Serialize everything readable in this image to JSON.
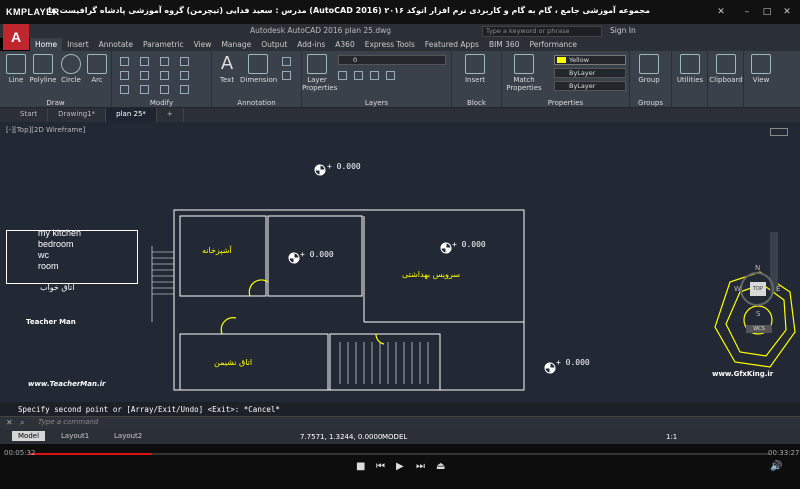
{
  "player": {
    "logo": "KMPLAYER",
    "title": "مجموعه آموزشی جامع ، گام به گام و کاربردی نرم افزار  اتوکد ۲۰۱۶ (AutoCAD 2016)  مدرس : سعید فدایی (تیچرمن) گروه آموزشی پادشاه گرافیست ها",
    "time_elapsed": "00:05:32",
    "time_total": "00:33:27",
    "progress": 0.1655
  },
  "acad": {
    "logo": "A",
    "doc_title": "Autodesk AutoCAD 2016  plan 25.dwg",
    "search_placeholder": "Type a keyword or phrase",
    "signin": "Sign In",
    "ribbon_tabs": [
      "Home",
      "Insert",
      "Annotate",
      "Parametric",
      "View",
      "Manage",
      "Output",
      "Add-ins",
      "A360",
      "Express Tools",
      "Featured Apps",
      "BIM 360",
      "Performance"
    ],
    "active_tab": "Home",
    "panels": {
      "draw": {
        "label": "Draw",
        "line": "Line",
        "polyline": "Polyline",
        "circle": "Circle",
        "arc": "Arc"
      },
      "modify": {
        "label": "Modify"
      },
      "annotation": {
        "label": "Annotation",
        "text": "Text",
        "dimension": "Dimension"
      },
      "layers": {
        "label": "Layers",
        "layer_props": "Layer\nProperties",
        "current_layer": "0"
      },
      "block": {
        "label": "Block",
        "insert": "Insert"
      },
      "properties": {
        "label": "Properties",
        "match": "Match\nProperties",
        "color": "Yellow",
        "linetype": "ByLayer",
        "lineweight": "ByLayer"
      },
      "groups": {
        "label": "Groups",
        "group": "Group"
      },
      "utilities": {
        "label": "Utilities"
      },
      "clipboard": {
        "label": "Clipboard"
      },
      "view": {
        "label": "View"
      }
    },
    "file_tabs": [
      "Start",
      "Drawing1*",
      "plan 25*"
    ],
    "active_file": "plan 25*",
    "viewport_label": "[-][Top][2D Wireframe]",
    "drawing": {
      "elevations": [
        "+ 0.000",
        "+ 0.000",
        "+ 0.000",
        "+ 0.000"
      ],
      "room_list": [
        "my kitchen",
        "bedroom",
        "wc",
        "room"
      ],
      "room_list_fa": "اتاق خواب",
      "kitchen": "آشپزخانه",
      "bathroom": "سرویس بهداشتی",
      "living": "اتاق نشیمن",
      "watermark_left": "www.TeacherMan.ir",
      "watermark_right": "www.GfxKing.ir",
      "badge_name": "Teacher Man"
    },
    "viewcube": {
      "top": "TOP",
      "n": "N",
      "s": "S",
      "e": "E",
      "w": "W",
      "wcs": "WCS"
    },
    "command_history": "Specify second point or [Array/Exit/Undo] <Exit>: *Cancel*",
    "command_placeholder": "Type a command",
    "layout_tabs": [
      "Model",
      "Layout1",
      "Layout2"
    ],
    "active_layout": "Model",
    "coords": "7.7571, 1.3244, 0.0000",
    "model_button": "MODEL",
    "scale": "1:1"
  }
}
